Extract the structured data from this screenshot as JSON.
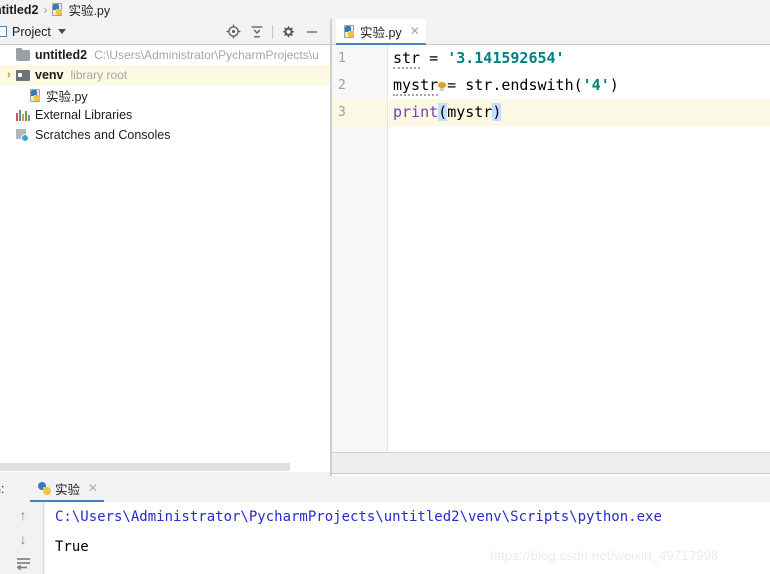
{
  "breadcrumb": {
    "project": "ntitled2",
    "separator": "›",
    "file": "实验.py",
    "file_icon": "python-file-icon"
  },
  "project_panel": {
    "title": "Project",
    "caret_icon": "chevron-down-icon",
    "toolbar": [
      {
        "name": "locate-target-icon",
        "tooltip": "Select Opened File"
      },
      {
        "name": "collapse-all-icon",
        "tooltip": "Collapse All"
      },
      {
        "name": "gear-icon",
        "tooltip": "Settings"
      },
      {
        "name": "minimize-icon",
        "tooltip": "Hide"
      }
    ],
    "tree": [
      {
        "label": "untitled2",
        "detail": "C:\\Users\\Administrator\\PycharmProjects\\u",
        "icon": "folder-icon",
        "bold": true,
        "indent": 0,
        "arrow": "",
        "highlighted": false
      },
      {
        "label": "venv",
        "detail": "library root",
        "icon": "venv-folder-icon",
        "bold": true,
        "indent": 1,
        "arrow": "›",
        "highlighted": true
      },
      {
        "label": "实验.py",
        "detail": "",
        "icon": "python-file-icon",
        "bold": false,
        "indent": 2,
        "arrow": "",
        "highlighted": false
      },
      {
        "label": "External Libraries",
        "detail": "",
        "icon": "external-libraries-icon",
        "bold": false,
        "indent": 0,
        "arrow": "",
        "highlighted": false
      },
      {
        "label": "Scratches and Consoles",
        "detail": "",
        "icon": "scratches-icon",
        "bold": false,
        "indent": 0,
        "arrow": "",
        "highlighted": false
      }
    ]
  },
  "editor": {
    "tab": {
      "label": "实验.py",
      "close_icon": "close-icon",
      "icon": "python-file-icon"
    },
    "line_numbers": [
      "1",
      "2",
      "3"
    ],
    "current_line": 3,
    "lines": [
      {
        "number": "1",
        "tokens": [
          {
            "text": "str",
            "type": "plain",
            "squiggle": true
          },
          {
            "text": " = ",
            "type": "plain"
          },
          {
            "text": "'3.141592654'",
            "type": "string"
          }
        ]
      },
      {
        "number": "2",
        "tokens": [
          {
            "text": "mystr",
            "type": "plain",
            "squiggle": true,
            "bulb": true
          },
          {
            "text": " = str.endswith(",
            "type": "plain"
          },
          {
            "text": "'4'",
            "type": "string"
          },
          {
            "text": ")",
            "type": "plain"
          }
        ]
      },
      {
        "number": "3",
        "tokens": [
          {
            "text": "print",
            "type": "keyword"
          },
          {
            "text": "(",
            "type": "brace"
          },
          {
            "text": "mystr",
            "type": "plain"
          },
          {
            "text": ")",
            "type": "brace"
          }
        ]
      }
    ]
  },
  "run_panel": {
    "label": "n:",
    "tab": {
      "label": "实验",
      "icon": "python-run-icon",
      "close_icon": "close-icon"
    },
    "side_buttons": [
      {
        "name": "scroll-up-icon",
        "glyph": "↑"
      },
      {
        "name": "scroll-down-icon",
        "glyph": "↓"
      },
      {
        "name": "soft-wrap-icon",
        "glyph": "↩"
      }
    ],
    "console": [
      {
        "text": "C:\\Users\\Administrator\\PycharmProjects\\untitled2\\venv\\Scripts\\python.exe",
        "type": "command"
      },
      {
        "text": "True",
        "type": "output"
      }
    ]
  },
  "watermark": "https://blog.csdn.net/weixin_49717998",
  "colors": {
    "accent": "#4083c9",
    "string": "#008080",
    "keyword": "#6f42c1",
    "brace_highlight": "#c5dffb",
    "current_line": "#fdf8e3",
    "tree_highlight": "#fdf9e3",
    "console_command": "#2929cc",
    "panel_bg": "#f2f2f2"
  }
}
